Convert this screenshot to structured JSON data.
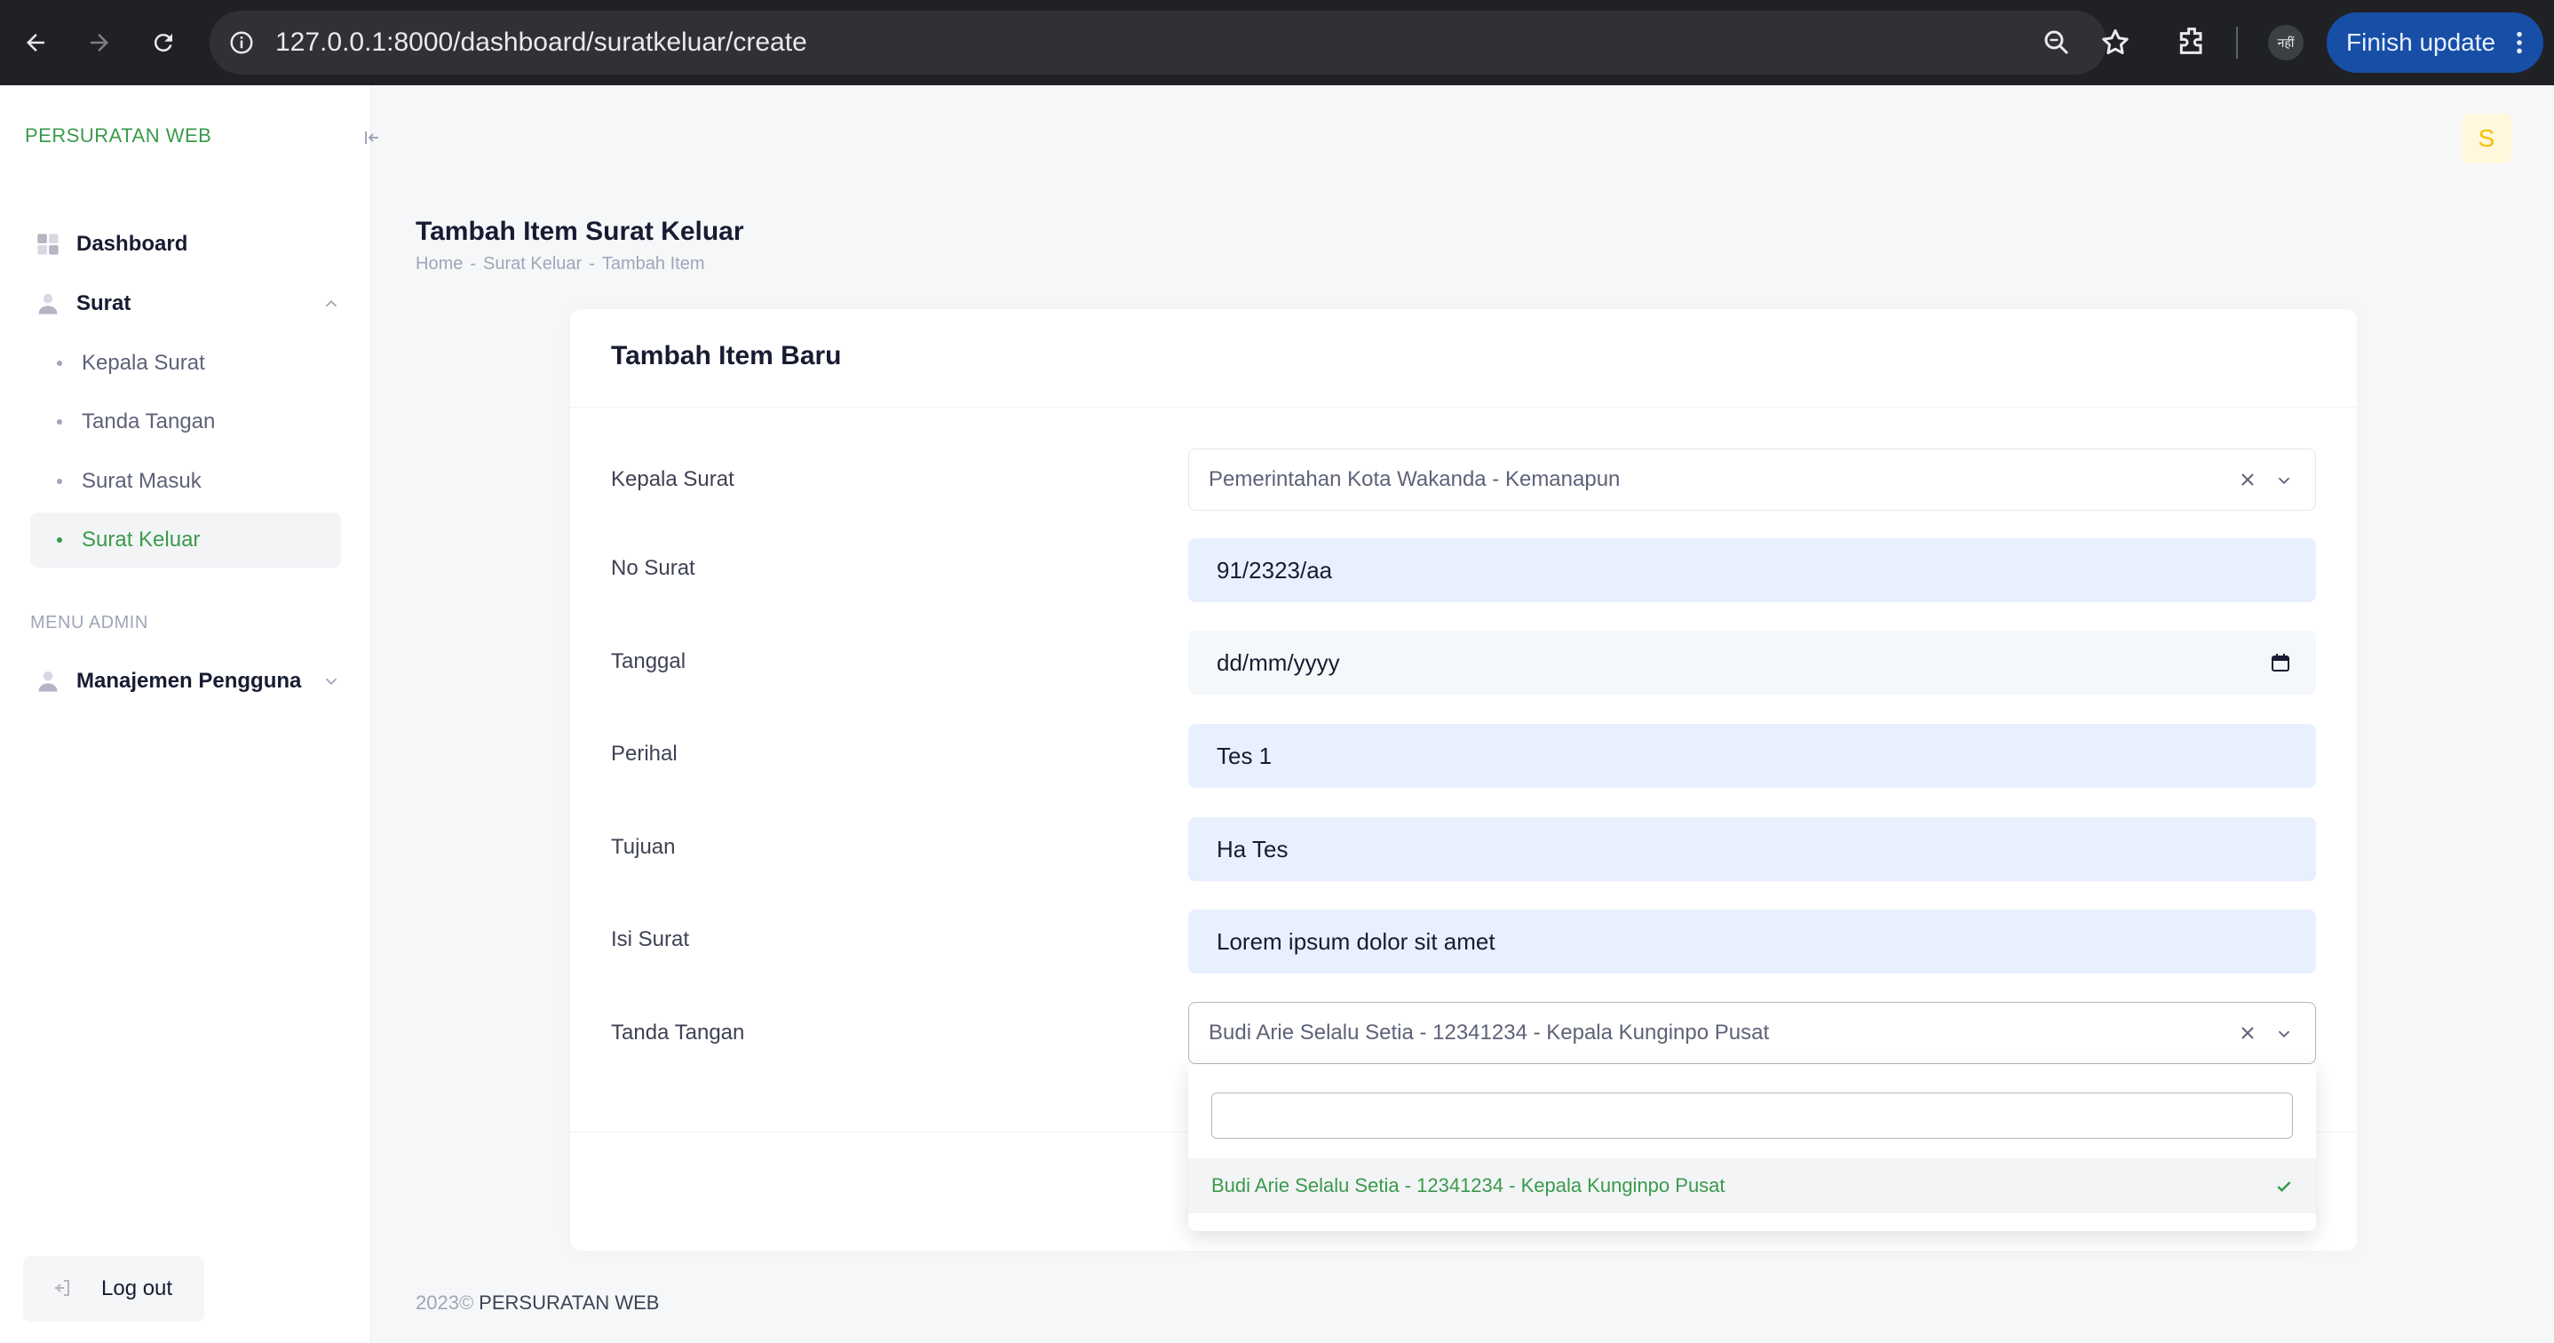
{
  "browser": {
    "url": "127.0.0.1:8000/dashboard/suratkeluar/create",
    "finish_update_label": "Finish update",
    "profile_initials": "नहीं"
  },
  "sidebar": {
    "brand": "PERSURATAN WEB",
    "menu": {
      "dashboard": "Dashboard",
      "surat": "Surat",
      "sub_items": [
        "Kepala Surat",
        "Tanda Tangan",
        "Surat Masuk",
        "Surat Keluar"
      ],
      "active_item": "Surat Keluar",
      "section_admin": "MENU ADMIN",
      "manajemen": "Manajemen Pengguna"
    },
    "logout_label": "Log out"
  },
  "topbar": {
    "avatar_letter": "S"
  },
  "page": {
    "title": "Tambah Item Surat Keluar",
    "breadcrumb": [
      "Home",
      "-",
      "Surat Keluar",
      "-",
      "Tambah Item"
    ]
  },
  "card": {
    "title": "Tambah Item Baru",
    "fields": {
      "kepala_surat": {
        "label": "Kepala Surat",
        "value": "Pemerintahan Kota Wakanda - Kemanapun"
      },
      "no_surat": {
        "label": "No Surat",
        "value": "91/2323/aa"
      },
      "tanggal": {
        "label": "Tanggal",
        "value": "dd/mm/yyyy"
      },
      "perihal": {
        "label": "Perihal",
        "value": "Tes 1"
      },
      "tujuan": {
        "label": "Tujuan",
        "value": "Ha Tes"
      },
      "isi_surat": {
        "label": "Isi Surat",
        "value": "Lorem ipsum dolor sit amet"
      },
      "tanda_tangan": {
        "label": "Tanda Tangan",
        "value": "Budi Arie Selalu Setia - 12341234 - Kepala Kunginpo Pusat"
      }
    },
    "dropdown": {
      "search_value": "",
      "options": [
        "Budi Arie Selalu Setia - 12341234 - Kepala Kunginpo Pusat"
      ]
    }
  },
  "footer": {
    "year": "2023©",
    "name": "PERSURATAN WEB"
  },
  "colors": {
    "accent": "#3a9a4b",
    "chrome_bg": "#202124",
    "update_btn": "#174ea6",
    "input_fill": "#e8f0fe"
  }
}
